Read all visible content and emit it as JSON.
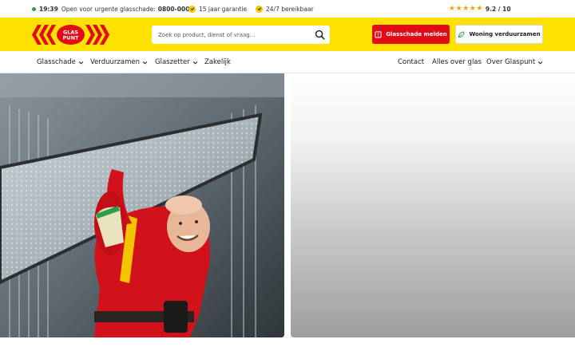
{
  "topbar": {
    "time": "19:39",
    "open_text": "Open voor urgente glasschade:",
    "phone": "0800-0003",
    "guarantee": "15 jaar garantie",
    "availability": "24/7 bereikbaar",
    "rating": "9.2 / 10",
    "stars": 5
  },
  "header": {
    "logo_text_line1": "GLAS",
    "logo_text_line2": "PUNT",
    "search_placeholder": "Zoek op product, dienst of vraag...",
    "btn_damage": "Glasschade melden",
    "btn_sustain": "Woning verduurzamen"
  },
  "nav": {
    "left": [
      {
        "label": "Glasschade",
        "dropdown": true
      },
      {
        "label": "Verduurzamen",
        "dropdown": true
      },
      {
        "label": "Glaszetter",
        "dropdown": true
      },
      {
        "label": "Zakelijk",
        "dropdown": false
      }
    ],
    "right": [
      {
        "label": "Contact",
        "dropdown": false
      },
      {
        "label": "Alles over glas",
        "dropdown": false
      },
      {
        "label": "Over Glaspunt",
        "dropdown": true
      }
    ]
  },
  "colors": {
    "brand_yellow": "#ffe100",
    "brand_red": "#e20b17",
    "status_green": "#2e9e48",
    "star": "#f5a300"
  }
}
